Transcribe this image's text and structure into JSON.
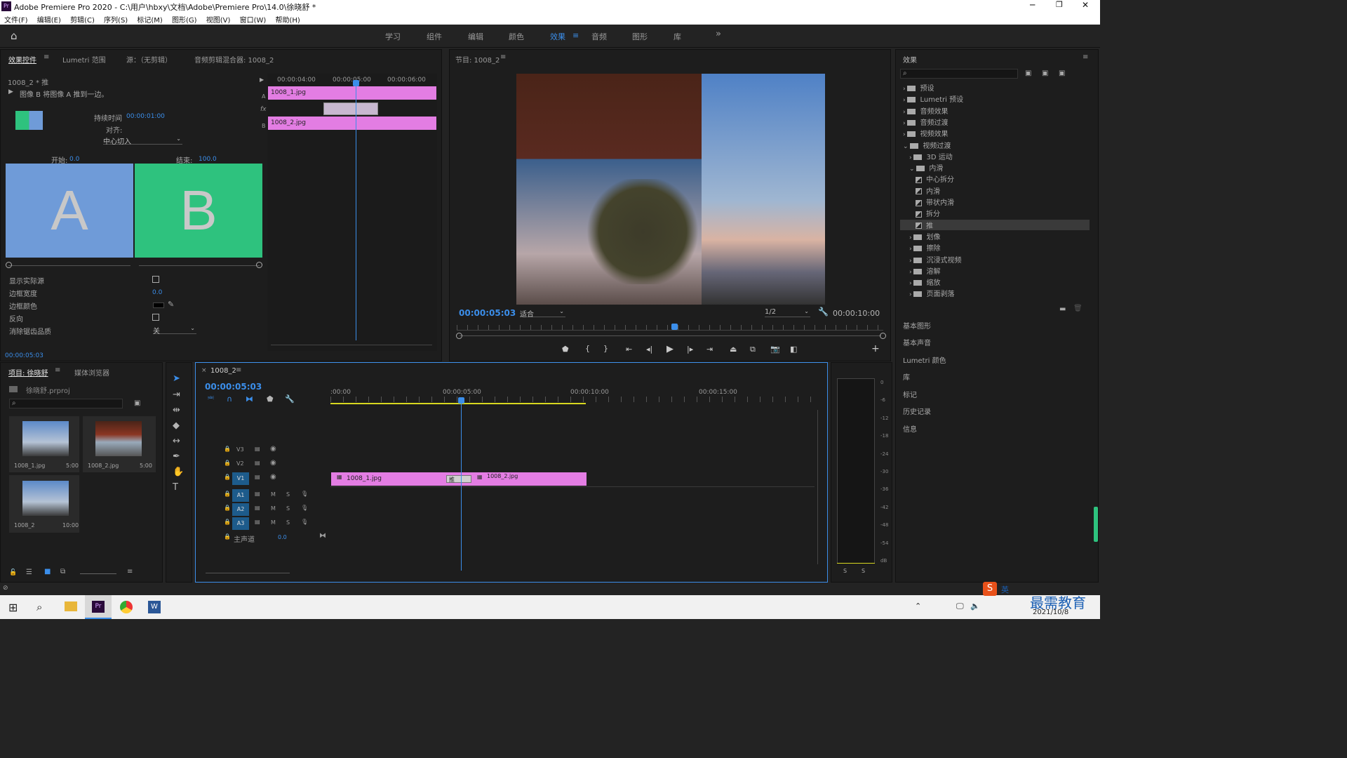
{
  "app": {
    "title": "Adobe Premiere Pro 2020 - C:\\用户\\hbxy\\文档\\Adobe\\Premiere Pro\\14.0\\徐晓舒 *",
    "logo": "Pr"
  },
  "menu": [
    "文件(F)",
    "编辑(E)",
    "剪辑(C)",
    "序列(S)",
    "标记(M)",
    "图形(G)",
    "视图(V)",
    "窗口(W)",
    "帮助(H)"
  ],
  "workspaces": [
    "学习",
    "组件",
    "编辑",
    "颜色",
    "效果",
    "音频",
    "图形",
    "库"
  ],
  "workspace_active": "效果",
  "effect_controls": {
    "tabs": [
      "效果控件",
      "Lumetri 范围",
      "源：（无剪辑）",
      "音频剪辑混合器: 1008_2"
    ],
    "clip_name": "1008_2 * 推",
    "description": "图像 B 将图像 A 推到一边。",
    "duration_label": "持续时间",
    "duration_value": "00:00:01:00",
    "align_label": "对齐:",
    "align_value": "中心切入",
    "start_label": "开始:",
    "start_value": "0.0",
    "end_label": "结束:",
    "end_value": "100.0",
    "preview_a": "A",
    "preview_b": "B",
    "props": [
      {
        "label": "显示实际源"
      },
      {
        "label": "边框宽度",
        "value": "0.0"
      },
      {
        "label": "边框颜色"
      },
      {
        "label": "反向"
      },
      {
        "label": "消除锯齿品质",
        "value": "关"
      }
    ],
    "timecode": "00:00:05:03",
    "mini_timeline": {
      "t1": "00:00:04:00",
      "t2": "00:00:05:00",
      "t3": "00:00:06:00",
      "clip_a": "1008_1.jpg",
      "clip_b": "1008_2.jpg",
      "track_a": "A",
      "track_b": "B",
      "fx": "fx"
    }
  },
  "program": {
    "title": "节目: 1008_2",
    "timecode": "00:00:05:03",
    "fit": "适合",
    "quality": "1/2",
    "duration": "00:00:10:00",
    "playhead_fraction": 0.5
  },
  "project": {
    "tabs": [
      "项目: 徐晓舒",
      "媒体浏览器"
    ],
    "file": "徐晓舒.prproj",
    "items": [
      {
        "name": "1008_1.jpg",
        "dur": "5:00"
      },
      {
        "name": "1008_2.jpg",
        "dur": "5:00"
      },
      {
        "name": "1008_2",
        "dur": "10:00"
      }
    ]
  },
  "timeline": {
    "tab": "1008_2",
    "timecode": "00:00:05:03",
    "ruler": [
      ":00:00",
      "00:00:05:00",
      "00:00:10:00",
      "00:00:15:00"
    ],
    "video_tracks": [
      "V3",
      "V2",
      "V1"
    ],
    "audio_tracks": [
      "A1",
      "A2",
      "A3"
    ],
    "master_label": "主声道",
    "master_value": "0.0",
    "clip1": "1008_1.jpg",
    "clip2": "1008_2.jpg",
    "transition": "推",
    "mute": "M",
    "solo": "S"
  },
  "meter": {
    "scale": [
      "0",
      "-6",
      "-12",
      "-18",
      "-24",
      "-30",
      "-36",
      "-42",
      "-48",
      "-54",
      "dB"
    ],
    "solo": [
      "S",
      "S"
    ]
  },
  "effects": {
    "title": "效果",
    "tree": [
      {
        "label": "预设",
        "indent": 0,
        "type": "folder"
      },
      {
        "label": "Lumetri 预设",
        "indent": 0,
        "type": "folder"
      },
      {
        "label": "音频效果",
        "indent": 0,
        "type": "folder"
      },
      {
        "label": "音频过渡",
        "indent": 0,
        "type": "folder"
      },
      {
        "label": "视频效果",
        "indent": 0,
        "type": "folder"
      },
      {
        "label": "视频过渡",
        "indent": 0,
        "type": "folder",
        "open": true
      },
      {
        "label": "3D 运动",
        "indent": 1,
        "type": "folder"
      },
      {
        "label": "内滑",
        "indent": 1,
        "type": "folder",
        "open": true
      },
      {
        "label": "中心拆分",
        "indent": 2,
        "type": "effect"
      },
      {
        "label": "内滑",
        "indent": 2,
        "type": "effect"
      },
      {
        "label": "带状内滑",
        "indent": 2,
        "type": "effect"
      },
      {
        "label": "拆分",
        "indent": 2,
        "type": "effect"
      },
      {
        "label": "推",
        "indent": 2,
        "type": "effect",
        "selected": true
      },
      {
        "label": "划像",
        "indent": 1,
        "type": "folder"
      },
      {
        "label": "擦除",
        "indent": 1,
        "type": "folder"
      },
      {
        "label": "沉浸式视频",
        "indent": 1,
        "type": "folder"
      },
      {
        "label": "溶解",
        "indent": 1,
        "type": "folder"
      },
      {
        "label": "缩放",
        "indent": 1,
        "type": "folder"
      },
      {
        "label": "页面剥落",
        "indent": 1,
        "type": "folder"
      }
    ],
    "sections": [
      "基本图形",
      "基本声音",
      "Lumetri 颜色",
      "库",
      "标记",
      "历史记录",
      "信息"
    ]
  },
  "taskbar": {
    "date": "2021/10/8",
    "ime": "英",
    "watermark": "最需教育"
  }
}
